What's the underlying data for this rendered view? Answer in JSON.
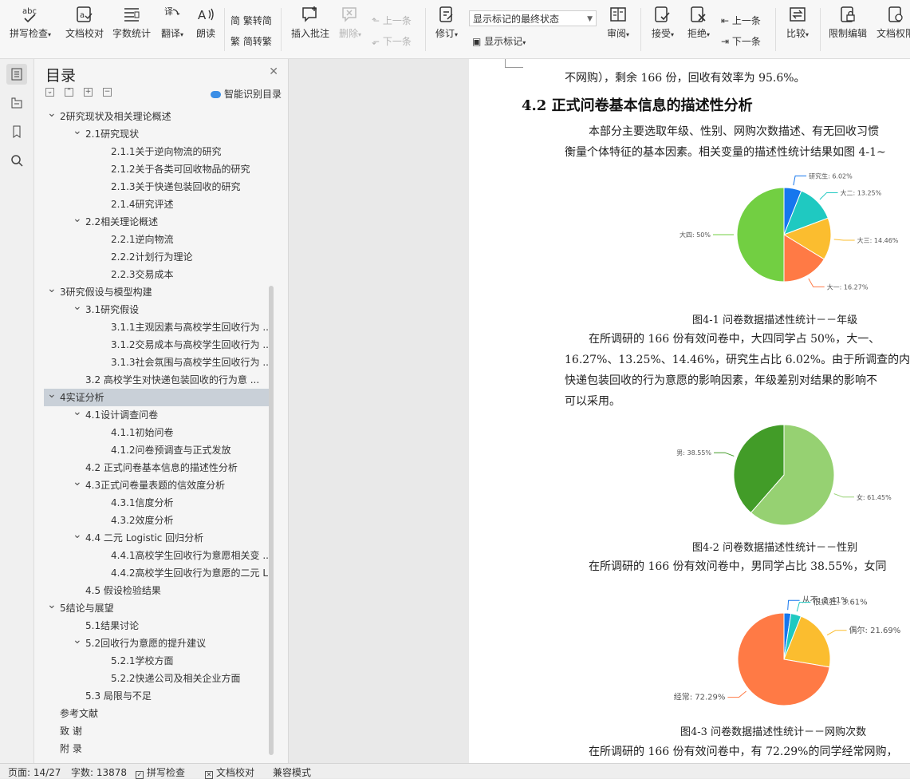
{
  "toolbar": {
    "spell_check": "拼写检查",
    "doc_proof": "文档校对",
    "word_count": "字数统计",
    "translate": "翻译",
    "read_aloud": "朗读",
    "trad_to_simp": "繁转简",
    "simp_to_trad": "简转繁",
    "insert_comment": "插入批注",
    "delete": "删除",
    "prev_comment": "上一条",
    "next_comment": "下一条",
    "track_changes": "修订",
    "markup_dropdown": "显示标记的最终状态",
    "show_markup": "显示标记",
    "review": "审阅",
    "accept": "接受",
    "reject": "拒绝",
    "prev_change": "上一条",
    "next_change": "下一条",
    "compare": "比较",
    "restrict_editing": "限制编辑",
    "doc_permission": "文档权限"
  },
  "toc": {
    "title": "目录",
    "smart_toc": "智能识别目录",
    "items": [
      {
        "level": 0,
        "caret": "v",
        "label": "2研究现状及相关理论概述"
      },
      {
        "level": 1,
        "caret": "v",
        "label": "2.1研究现状"
      },
      {
        "level": 2,
        "caret": "",
        "label": "2.1.1关于逆向物流的研究"
      },
      {
        "level": 2,
        "caret": "",
        "label": "2.1.2关于各类可回收物品的研究"
      },
      {
        "level": 2,
        "caret": "",
        "label": "2.1.3关于快递包装回收的研究"
      },
      {
        "level": 2,
        "caret": "",
        "label": "2.1.4研究评述"
      },
      {
        "level": 1,
        "caret": "v",
        "label": "2.2相关理论概述"
      },
      {
        "level": 2,
        "caret": "",
        "label": "2.2.1逆向物流"
      },
      {
        "level": 2,
        "caret": "",
        "label": "2.2.2计划行为理论"
      },
      {
        "level": 2,
        "caret": "",
        "label": "2.2.3交易成本"
      },
      {
        "level": 0,
        "caret": "v",
        "label": "3研究假设与模型构建"
      },
      {
        "level": 1,
        "caret": "v",
        "label": "3.1研究假设"
      },
      {
        "level": 2,
        "caret": "",
        "label": "3.1.1主观因素与高校学生回收行为 ..."
      },
      {
        "level": 2,
        "caret": "",
        "label": "3.1.2交易成本与高校学生回收行为 ..."
      },
      {
        "level": 2,
        "caret": "",
        "label": "3.1.3社会氛围与高校学生回收行为 ..."
      },
      {
        "level": 1,
        "caret": "",
        "label": "3.2 高校学生对快递包装回收的行为意 ..."
      },
      {
        "level": 0,
        "caret": "v",
        "label": "4实证分析",
        "selected": true
      },
      {
        "level": 1,
        "caret": "v",
        "label": "4.1设计调查问卷"
      },
      {
        "level": 2,
        "caret": "",
        "label": "4.1.1初始问卷"
      },
      {
        "level": 2,
        "caret": "",
        "label": "4.1.2问卷预调查与正式发放"
      },
      {
        "level": 1,
        "caret": "",
        "label": "4.2 正式问卷基本信息的描述性分析"
      },
      {
        "level": 1,
        "caret": "v",
        "label": "4.3正式问卷量表题的信效度分析"
      },
      {
        "level": 2,
        "caret": "",
        "label": "4.3.1信度分析"
      },
      {
        "level": 2,
        "caret": "",
        "label": "4.3.2效度分析"
      },
      {
        "level": 1,
        "caret": "v",
        "label": "4.4 二元 Logistic 回归分析"
      },
      {
        "level": 2,
        "caret": "",
        "label": "4.4.1高校学生回收行为意愿相关变 ..."
      },
      {
        "level": 2,
        "caret": "",
        "label": "4.4.2高校学生回收行为意愿的二元 L ..."
      },
      {
        "level": 1,
        "caret": "",
        "label": "4.5 假设检验结果"
      },
      {
        "level": 0,
        "caret": "v",
        "label": "5结论与展望"
      },
      {
        "level": 1,
        "caret": "",
        "label": "5.1结果讨论"
      },
      {
        "level": 1,
        "caret": "v",
        "label": "5.2回收行为意愿的提升建议"
      },
      {
        "level": 2,
        "caret": "",
        "label": "5.2.1学校方面"
      },
      {
        "level": 2,
        "caret": "",
        "label": "5.2.2快递公司及相关企业方面"
      },
      {
        "level": 1,
        "caret": "",
        "label": "5.3 局限与不足"
      },
      {
        "level": 0,
        "caret": "",
        "label": "参考文献"
      },
      {
        "level": 0,
        "caret": "",
        "label": "致 谢"
      },
      {
        "level": 0,
        "caret": "",
        "label": "附 录"
      }
    ]
  },
  "document": {
    "line_top": "不网购），剩余 166 份，回收有效率为  95.6%。",
    "heading": "4.2  正式问卷基本信息的描述性分析",
    "para1_l1": "本部分主要选取年级、性别、网购次数描述、有无回收习惯",
    "para1_l2": "衡量个体特征的基本因素。相关变量的描述性统计结果如图 4-1~",
    "fig1_caption": "图4-1   问卷数据描述性统计－－年级",
    "para2_l1": "在所调研的  166 份有效问卷中，大四同学占  50%，大一、",
    "para2_l2": "16.27%、13.25%、14.46%，研究生占比  6.02%。由于所调查的内",
    "para2_l3": "快递包装回收的行为意愿的影响因素，年级差别对结果的影响不",
    "para2_l4": "可以采用。",
    "fig2_caption": "图4-2   问卷数据描述性统计－－性别",
    "para3_l1": "在所调研的  166 份有效问卷中，男同学占比  38.55%，女同",
    "fig3_caption": "图4-3   问卷数据描述性统计－－网购次数",
    "para4_l1": "在所调研的  166 份有效问卷中，有  72.29%的同学经常网购，"
  },
  "chart_data": [
    {
      "type": "pie",
      "categories": [
        "研究生",
        "大二",
        "大三",
        "大一",
        "大四"
      ],
      "values": [
        6.02,
        13.25,
        14.46,
        16.27,
        50
      ],
      "labels": [
        "研究生: 6.02%",
        "大二: 13.25%",
        "大三: 14.46%",
        "大一: 16.27%",
        "大四: 50%"
      ],
      "colors": [
        "#1677ee",
        "#1fc9c1",
        "#fbbd2f",
        "#ff7a45",
        "#72cf42"
      ]
    },
    {
      "type": "pie",
      "categories": [
        "女",
        "男"
      ],
      "values": [
        61.45,
        38.55
      ],
      "labels": [
        "女: 61.45%",
        "男: 38.55%"
      ],
      "colors": [
        "#96d172",
        "#429c28"
      ]
    },
    {
      "type": "pie",
      "categories": [
        "从不",
        "很疯狂",
        "偶尔",
        "经常"
      ],
      "values": [
        2.41,
        3.61,
        21.69,
        72.29
      ],
      "labels": [
        "从不: 2.41%",
        "很疯狂: 3.61%",
        "偶尔: 21.69%",
        "经常: 72.29%"
      ],
      "colors": [
        "#1677ee",
        "#1fc9c1",
        "#fbbd2f",
        "#ff7a45"
      ]
    }
  ],
  "status": {
    "page": "页面: 14/27",
    "words": "字数: 13878",
    "spell": "拼写检查",
    "proof": "文档校对",
    "compat": "兼容模式"
  }
}
